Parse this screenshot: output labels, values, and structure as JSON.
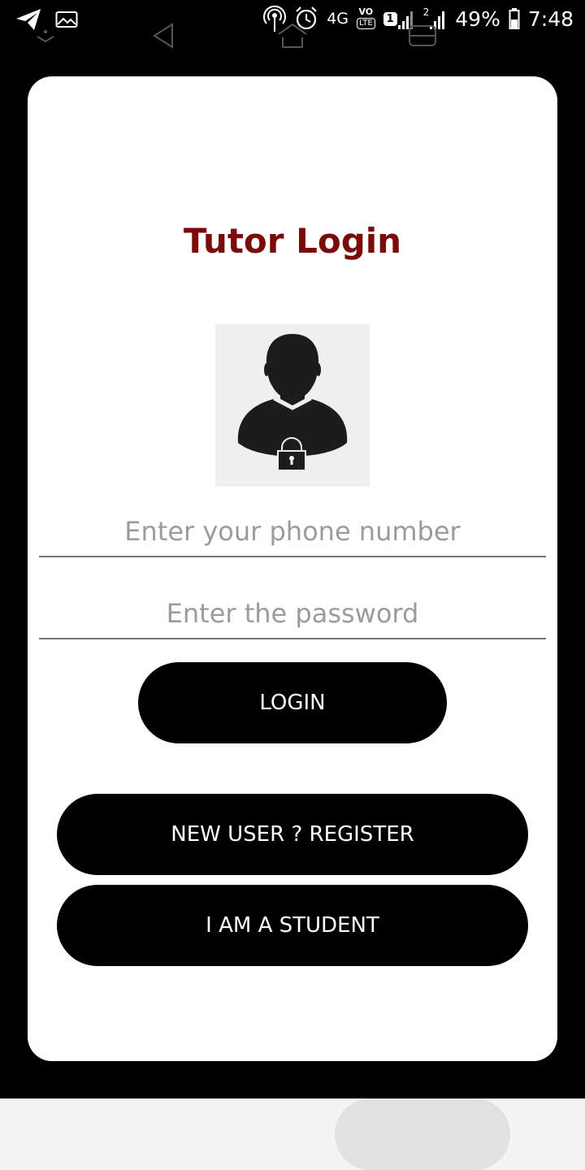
{
  "status_bar": {
    "network_type": "4G",
    "volte_label": "VO",
    "lte_label": "LTE",
    "sim1_label": "1",
    "sim2_label": "2",
    "battery_percent": "49%",
    "time": "7:48",
    "icons": [
      "telegram-icon",
      "gallery-icon",
      "hotspot-icon",
      "alarm-icon",
      "signal-icon",
      "battery-icon"
    ]
  },
  "login": {
    "title": "Tutor Login",
    "avatar_icon": "user-lock-icon",
    "phone_placeholder": "Enter your phone number",
    "password_placeholder": "Enter the password",
    "login_label": "LOGIN",
    "register_label": "NEW USER ? REGISTER",
    "student_label": "I AM A STUDENT"
  },
  "colors": {
    "title": "#7b0a0a",
    "button_bg": "#000000",
    "card_bg": "#ffffff"
  },
  "nav_bar": {
    "icons": [
      "hide-keyboard-icon",
      "back-icon",
      "home-icon",
      "recents-icon"
    ]
  }
}
